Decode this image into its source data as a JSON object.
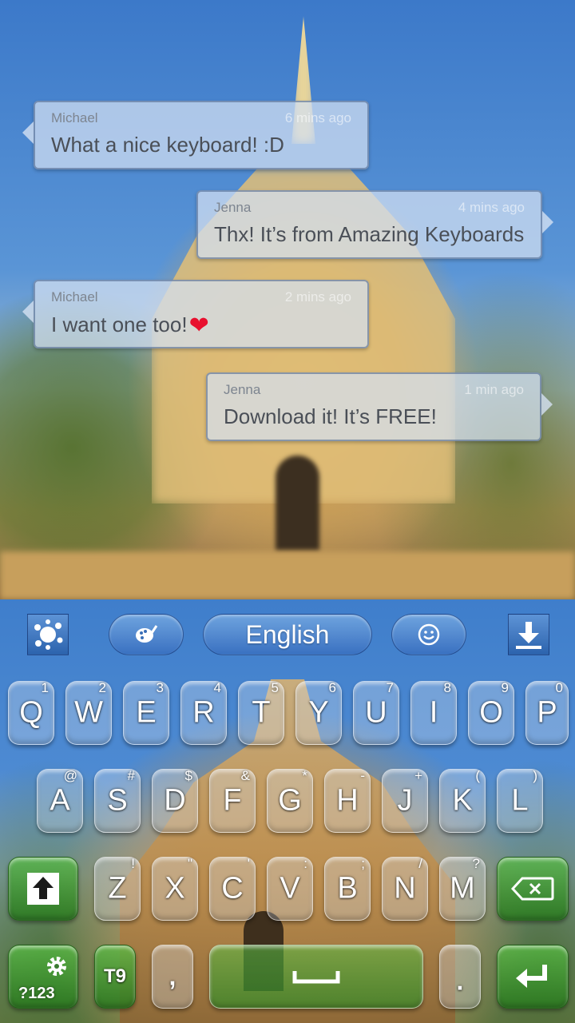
{
  "chat": {
    "messages": [
      {
        "sender": "Michael",
        "time": "6 mins ago",
        "text": "What a nice keyboard! :D",
        "side": "left"
      },
      {
        "sender": "Jenna",
        "time": "4 mins ago",
        "text": "Thx! It’s from Amazing Keyboards",
        "side": "right"
      },
      {
        "sender": "Michael",
        "time": "2 mins ago",
        "text": "I want one too!",
        "side": "left"
      },
      {
        "sender": "Jenna",
        "time": "1 min ago",
        "text": "Download it! It’s FREE!",
        "side": "right"
      }
    ]
  },
  "keyboard": {
    "toolbar": {
      "language_label": "English",
      "icons": [
        "splat-icon",
        "palette-icon",
        "smiley-icon",
        "download-icon"
      ]
    },
    "row1": [
      {
        "label": "Q",
        "hint": "1"
      },
      {
        "label": "W",
        "hint": "2"
      },
      {
        "label": "E",
        "hint": "3"
      },
      {
        "label": "R",
        "hint": "4"
      },
      {
        "label": "T",
        "hint": "5"
      },
      {
        "label": "Y",
        "hint": "6"
      },
      {
        "label": "U",
        "hint": "7"
      },
      {
        "label": "I",
        "hint": "8"
      },
      {
        "label": "O",
        "hint": "9"
      },
      {
        "label": "P",
        "hint": "0"
      }
    ],
    "row2": [
      {
        "label": "A",
        "hint": "@"
      },
      {
        "label": "S",
        "hint": "#"
      },
      {
        "label": "D",
        "hint": "$"
      },
      {
        "label": "F",
        "hint": "&"
      },
      {
        "label": "G",
        "hint": "*"
      },
      {
        "label": "H",
        "hint": "-"
      },
      {
        "label": "J",
        "hint": "+"
      },
      {
        "label": "K",
        "hint": "("
      },
      {
        "label": "L",
        "hint": ")"
      }
    ],
    "row3": [
      {
        "label": "Z",
        "hint": "!"
      },
      {
        "label": "X",
        "hint": "\""
      },
      {
        "label": "C",
        "hint": "'"
      },
      {
        "label": "V",
        "hint": ":"
      },
      {
        "label": "B",
        "hint": ";"
      },
      {
        "label": "N",
        "hint": "/"
      },
      {
        "label": "M",
        "hint": "?"
      }
    ],
    "bottom": {
      "symbols_label": "?123",
      "t9_label": "T9",
      "comma_label": ",",
      "period_label": "."
    }
  }
}
